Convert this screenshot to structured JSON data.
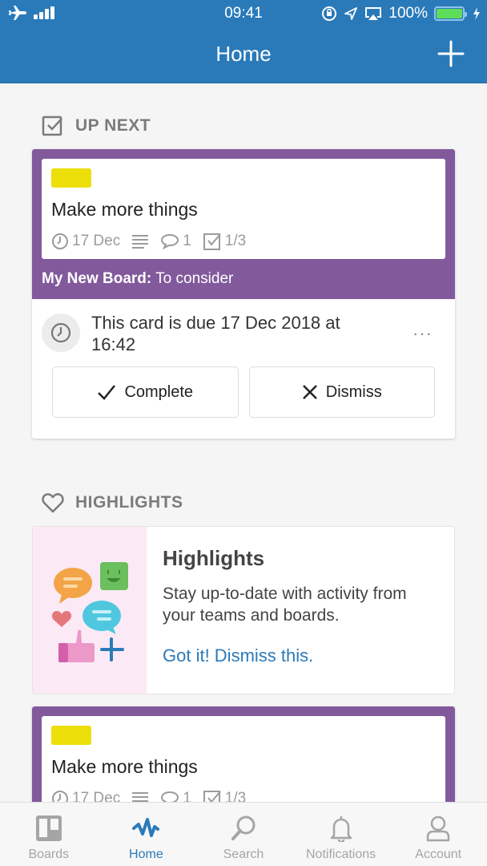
{
  "status_bar": {
    "time": "09:41",
    "battery": "100%",
    "battery_level": 1.0,
    "icons": [
      "airplane-icon",
      "signal-icon",
      "rotation-lock-icon",
      "location-icon",
      "airplay-icon",
      "battery-icon",
      "charging-icon"
    ]
  },
  "header": {
    "title": "Home",
    "add_icon": "plus-icon"
  },
  "up_next": {
    "heading": "UP NEXT",
    "icon": "checkbox-icon",
    "card": {
      "label_color": "#ecdf0a",
      "title": "Make more things",
      "due_badge": "17 Dec",
      "comments": "1",
      "checklist": "1/3",
      "board_name": "My New Board:",
      "list_name": " To consider",
      "frame_color": "#825a9c"
    },
    "due_message": "This card is due 17 Dec 2018 at 16:42",
    "more_label": "···",
    "complete_label": "Complete",
    "dismiss_label": "Dismiss"
  },
  "highlights": {
    "heading": "HIGHLIGHTS",
    "icon": "heart-icon",
    "title": "Highlights",
    "body": "Stay up-to-date with activity from your teams and boards.",
    "link": "Got it! Dismiss this."
  },
  "second_card": {
    "label_color": "#ecdf0a",
    "title": "Make more things",
    "due_badge": "17 Dec",
    "comments": "1",
    "checklist": "1/3"
  },
  "tabbar": {
    "tabs": [
      {
        "label": "Boards",
        "icon": "boards-icon",
        "active": false
      },
      {
        "label": "Home",
        "icon": "activity-icon",
        "active": true
      },
      {
        "label": "Search",
        "icon": "search-icon",
        "active": false
      },
      {
        "label": "Notifications",
        "icon": "bell-icon",
        "active": false
      },
      {
        "label": "Account",
        "icon": "person-icon",
        "active": false
      }
    ]
  },
  "colors": {
    "brand_blue": "#2a7ab9",
    "background": "#f5f5f6",
    "muted_text": "#7b7b7b"
  }
}
